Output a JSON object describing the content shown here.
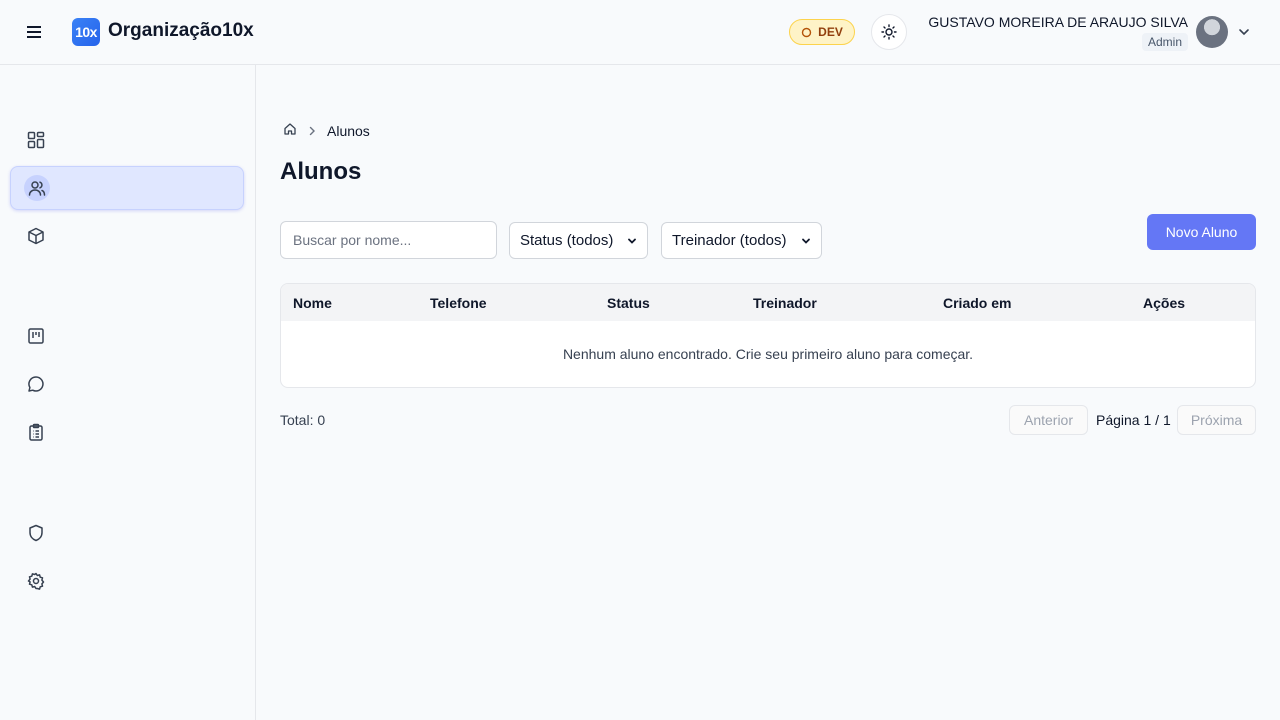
{
  "header": {
    "logo_text": "10x",
    "brand": "Organização10x",
    "env_badge": "DEV",
    "user_name": "GUSTAVO MOREIRA DE ARAUJO SILVA",
    "user_role": "Admin"
  },
  "sidebar": {
    "items": [
      {
        "icon": "dashboard-icon"
      },
      {
        "icon": "users-icon",
        "active": true
      },
      {
        "icon": "package-icon"
      },
      {
        "icon": "kanban-icon"
      },
      {
        "icon": "message-circle-icon"
      },
      {
        "icon": "clipboard-list-icon"
      },
      {
        "icon": "shield-icon"
      },
      {
        "icon": "settings-icon"
      }
    ]
  },
  "breadcrumb": {
    "current": "Alunos"
  },
  "page": {
    "title": "Alunos"
  },
  "filters": {
    "search_placeholder": "Buscar por nome...",
    "status_value": "Status (todos)",
    "trainer_value": "Treinador (todos)",
    "new_button": "Novo Aluno"
  },
  "table": {
    "columns": [
      "Nome",
      "Telefone",
      "Status",
      "Treinador",
      "Criado em",
      "Ações"
    ],
    "empty_message": "Nenhum aluno encontrado. Crie seu primeiro aluno para começar."
  },
  "pagination": {
    "total": "Total: 0",
    "prev": "Anterior",
    "page": "Página 1 / 1",
    "next": "Próxima"
  },
  "colors": {
    "accent": "#6477f5",
    "active_nav": "#e0e7ff",
    "badge_bg": "#fef3c7"
  }
}
